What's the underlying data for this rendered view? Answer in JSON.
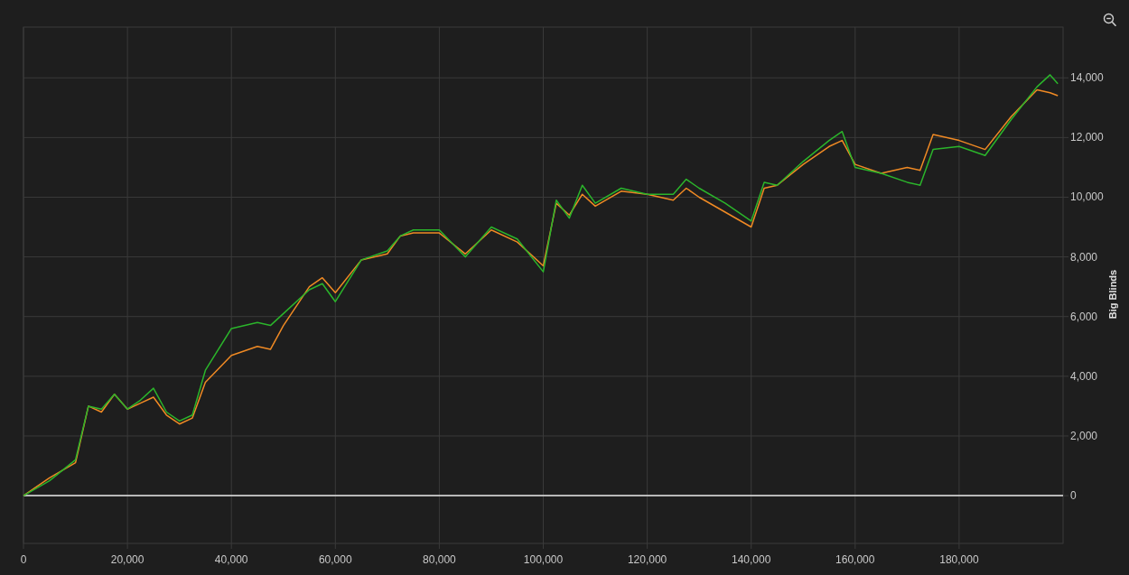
{
  "chart_data": {
    "type": "line",
    "grid": true,
    "ylabel": "Big Blinds",
    "xlim": [
      0,
      200000
    ],
    "ylim": [
      -1600,
      15700
    ],
    "xticks": [
      {
        "value": 0,
        "label": "0"
      },
      {
        "value": 20000,
        "label": "20,000"
      },
      {
        "value": 40000,
        "label": "40,000"
      },
      {
        "value": 60000,
        "label": "60,000"
      },
      {
        "value": 80000,
        "label": "80,000"
      },
      {
        "value": 100000,
        "label": "100,000"
      },
      {
        "value": 120000,
        "label": "120,000"
      },
      {
        "value": 140000,
        "label": "140,000"
      },
      {
        "value": 160000,
        "label": "160,000"
      },
      {
        "value": 180000,
        "label": "180,000"
      }
    ],
    "yticks": [
      {
        "value": 0,
        "label": "0"
      },
      {
        "value": 2000,
        "label": "2,000"
      },
      {
        "value": 4000,
        "label": "4,000"
      },
      {
        "value": 6000,
        "label": "6,000"
      },
      {
        "value": 8000,
        "label": "8,000"
      },
      {
        "value": 10000,
        "label": "10,000"
      },
      {
        "value": 12000,
        "label": "12,000"
      },
      {
        "value": 14000,
        "label": "14,000"
      }
    ],
    "x": [
      0,
      5000,
      10000,
      12500,
      15000,
      17500,
      20000,
      22500,
      25000,
      27500,
      30000,
      32500,
      35000,
      40000,
      45000,
      47500,
      50000,
      55000,
      57500,
      60000,
      65000,
      70000,
      72500,
      75000,
      80000,
      85000,
      90000,
      95000,
      100000,
      102500,
      105000,
      107500,
      110000,
      115000,
      120000,
      125000,
      127500,
      130000,
      135000,
      140000,
      142500,
      145000,
      150000,
      155000,
      157500,
      160000,
      165000,
      170000,
      172500,
      175000,
      180000,
      185000,
      190000,
      195000,
      197500,
      199000
    ],
    "series": [
      {
        "color": "#f08a24",
        "values": [
          0,
          600,
          1100,
          3000,
          2800,
          3400,
          2900,
          3100,
          3300,
          2700,
          2400,
          2600,
          3800,
          4700,
          5000,
          4900,
          5700,
          7000,
          7300,
          6800,
          7900,
          8100,
          8700,
          8800,
          8800,
          8100,
          8900,
          8500,
          7700,
          9800,
          9400,
          10100,
          9700,
          10200,
          10100,
          9900,
          10300,
          10000,
          9500,
          9000,
          10300,
          10400,
          11100,
          11700,
          11900,
          11100,
          10800,
          11000,
          10900,
          12100,
          11900,
          11600,
          12700,
          13600,
          13500,
          13400
        ]
      },
      {
        "color": "#2bb52b",
        "values": [
          0,
          500,
          1200,
          3000,
          2900,
          3400,
          2900,
          3200,
          3600,
          2800,
          2500,
          2700,
          4200,
          5600,
          5800,
          5700,
          6100,
          6900,
          7100,
          6500,
          7900,
          8200,
          8700,
          8900,
          8900,
          8000,
          9000,
          8600,
          7500,
          9900,
          9300,
          10400,
          9800,
          10300,
          10100,
          10100,
          10600,
          10300,
          9800,
          9200,
          10500,
          10400,
          11200,
          11900,
          12200,
          11000,
          10800,
          10500,
          10400,
          11600,
          11700,
          11400,
          12600,
          13700,
          14100,
          13800
        ]
      }
    ]
  }
}
